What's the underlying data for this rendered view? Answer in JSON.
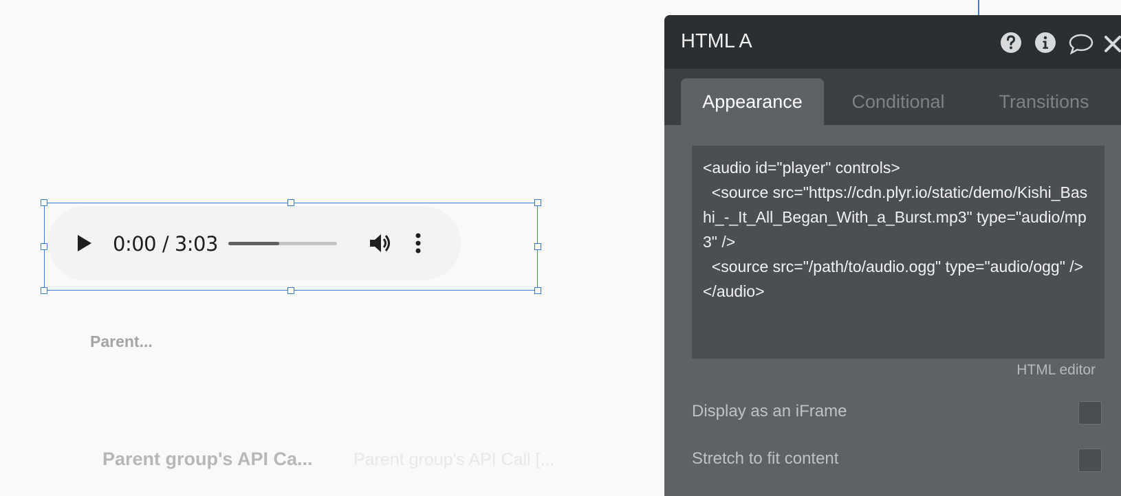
{
  "canvas": {
    "audio_player": {
      "time": "0:00 / 3:03",
      "progress_fraction": 0.47
    },
    "labels": {
      "parent": "Parent...",
      "api_call_bold": "Parent group's API Ca...",
      "api_call_faint": "Parent group's API Call [..."
    }
  },
  "panel": {
    "title": "HTML A",
    "header_icons": [
      "help-icon",
      "info-icon",
      "comment-icon",
      "close-icon"
    ],
    "tabs": [
      {
        "label": "Appearance",
        "active": true
      },
      {
        "label": "Conditional",
        "active": false
      },
      {
        "label": "Transitions",
        "active": false
      }
    ],
    "html_code": "<audio id=\"player\" controls>\n  <source src=\"https://cdn.plyr.io/static/demo/Kishi_Bashi_-_It_All_Began_With_a_Burst.mp3\" type=\"audio/mp3\" />\n  <source src=\"/path/to/audio.ogg\" type=\"audio/ogg\" />\n</audio>",
    "html_editor_label": "HTML editor",
    "properties": [
      {
        "label": "Display as an iFrame",
        "checked": false
      },
      {
        "label": "Stretch to fit content",
        "checked": false
      }
    ]
  },
  "colors": {
    "selection": "#3a7bd5",
    "panel_header": "#2b2f32",
    "panel_body": "#5e6266"
  }
}
